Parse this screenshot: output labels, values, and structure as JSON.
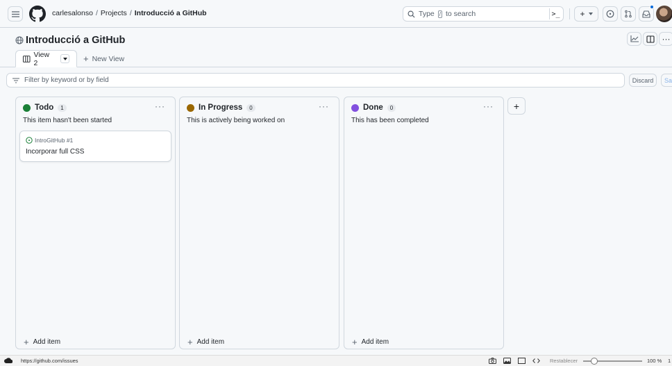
{
  "breadcrumbs": {
    "user": "carlesalonso",
    "sep": "/",
    "projects": "Projects",
    "current": "Introducció a GitHub"
  },
  "search": {
    "prefix": "Type",
    "key": "/",
    "suffix": "to search",
    "cmd": ">_"
  },
  "project": {
    "title": "Introducció a GitHub"
  },
  "tabs": {
    "active": "View 2",
    "new_view": "New View",
    "new_plus": "+"
  },
  "filter": {
    "placeholder": "Filter by keyword or by field",
    "discard": "Discard",
    "save": "Save"
  },
  "columns": [
    {
      "name": "Todo",
      "count": "1",
      "description": "This item hasn't been started",
      "color": "#1a7f37",
      "cards": [
        {
          "ref": "IntroGitHub #1",
          "title": "Incorporar full CSS"
        }
      ]
    },
    {
      "name": "In Progress",
      "count": "0",
      "description": "This is actively being worked on",
      "color": "#9a6700",
      "cards": []
    },
    {
      "name": "Done",
      "count": "0",
      "description": "This has been completed",
      "color": "#8250df",
      "cards": []
    }
  ],
  "add_item": "Add item",
  "more": "···",
  "plus": "+",
  "statusbar": {
    "url": "https://github.com/issues",
    "reset": "Restablecer",
    "zoom": "100 %",
    "zoom_level": 100,
    "edge": "1"
  },
  "colors": {
    "accent": "#0969da",
    "border": "#d0d7de",
    "bg": "#f6f8fa"
  }
}
